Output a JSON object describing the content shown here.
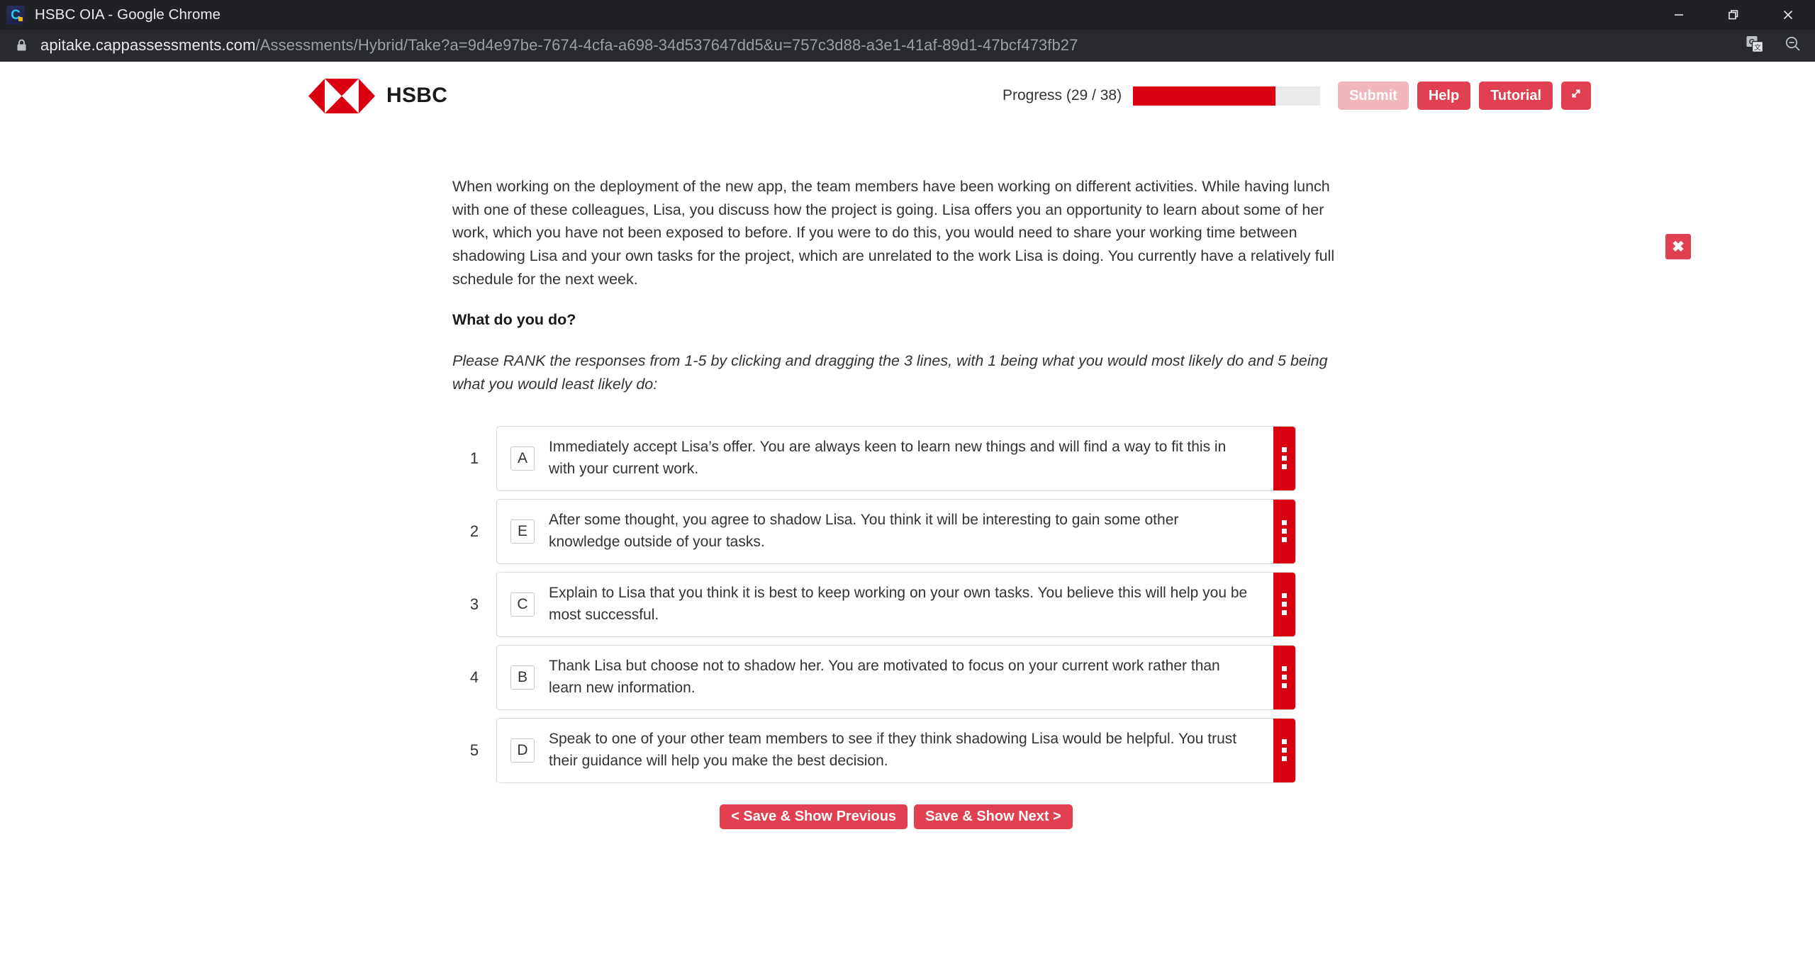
{
  "browser": {
    "favicon_letter": "C",
    "window_title": "HSBC OIA - Google Chrome",
    "minimize_label": "Minimize",
    "restore_label": "Restore",
    "close_label": "Close",
    "url_host": "apitake.cappassessments.com",
    "url_path": "/Assessments/Hybrid/Take?a=9d4e97be-7674-4cfa-a698-34d537647dd5&u=757c3d88-a3e1-41af-89d1-47bcf473fb27",
    "lock_icon": "lock-icon",
    "translate_icon": "google-translate-icon",
    "zoom_out_icon": "zoom-out-icon"
  },
  "header": {
    "brand_name": "HSBC",
    "brand_logo": "hsbc-hexagon-logo",
    "progress_label": "Progress (29 / 38)",
    "progress_current": 29,
    "progress_total": 38,
    "progress_percent": 76,
    "buttons": {
      "submit": "Submit",
      "help": "Help",
      "tutorial": "Tutorial",
      "expand_icon": "expand-arrows-icon"
    },
    "colors": {
      "brand_red": "#db0011",
      "button_red": "#e0404f",
      "button_disabled_pink": "#f2b7bd",
      "progress_track": "#e8eaec"
    }
  },
  "close_button": {
    "label": "✖",
    "name": "close-panel-button"
  },
  "main": {
    "scenario": "When working on the deployment of the new app, the team members have been working on different activities. While having lunch with one of these colleagues, Lisa, you discuss how the project is going. Lisa offers you an opportunity to learn about some of her work, which you have not been exposed to before. If you were to do this, you would need to share your working time between shadowing Lisa and your own tasks for the project, which are unrelated to the work Lisa is doing. You currently have a relatively full schedule for the next week.",
    "question": "What do you do?",
    "instruction": "Please RANK the responses from 1-5 by clicking and dragging the 3 lines, with 1 being what you would most likely do and 5 being what you would least likely do:",
    "ranked_options": [
      {
        "rank": "1",
        "letter": "A",
        "text": "Immediately accept Lisa’s offer. You are always keen to learn new things and will find a way to fit this in with your current work."
      },
      {
        "rank": "2",
        "letter": "E",
        "text": "After some thought, you agree to shadow Lisa. You think it will be interesting to gain some other knowledge outside of your tasks."
      },
      {
        "rank": "3",
        "letter": "C",
        "text": "Explain to Lisa that you think it is best to keep working on your own tasks. You believe this will help you be most successful."
      },
      {
        "rank": "4",
        "letter": "B",
        "text": "Thank Lisa but choose not to shadow her. You are motivated to focus on your current work rather than learn new information."
      },
      {
        "rank": "5",
        "letter": "D",
        "text": "Speak to one of your other team members to see if they think shadowing Lisa would be helpful. You trust their guidance will help you make the best decision."
      }
    ],
    "nav": {
      "previous": "< Save & Show Previous",
      "next": "Save & Show Next >"
    }
  }
}
